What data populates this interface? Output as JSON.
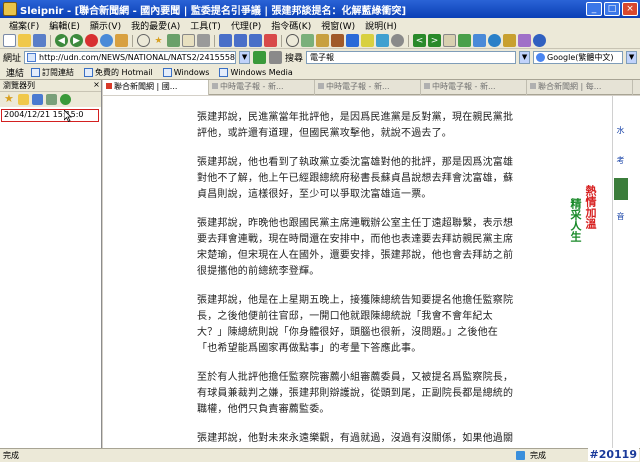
{
  "window": {
    "title": "Sleipnir - [聯合新聞網 - 國內要聞 | 監委提名引爭議 | 張建邦談提名：化解藍綠衝突]"
  },
  "menubar": {
    "items": [
      "檔案(F)",
      "編輯(E)",
      "顯示(V)",
      "我的最愛(A)",
      "工具(T)",
      "代理(P)",
      "指令碼(K)",
      "視窗(W)",
      "說明(H)"
    ]
  },
  "address": {
    "label": "網址",
    "url": "http://udn.com/NEWS/NATIONAL/NATS2/2415558.shtml",
    "search_label": "搜尋",
    "search_value": "電子報",
    "engine": "Google(繁體中文)"
  },
  "links": {
    "label": "連結",
    "items": [
      "訂閱連結",
      "免費的 Hotmail",
      "Windows",
      "Windows Media"
    ]
  },
  "sidebar": {
    "title": "瀏覽器列",
    "history_entry": "2004/12/21 15:15:0"
  },
  "tabs": [
    {
      "label": "聯合新聞網 | 國...",
      "active": true
    },
    {
      "label": "中時電子報 - 新...",
      "active": false
    },
    {
      "label": "中時電子報 - 新...",
      "active": false
    },
    {
      "label": "中時電子報 - 新...",
      "active": false
    },
    {
      "label": "聯合新聞網 | 每...",
      "active": false
    }
  ],
  "article": {
    "paragraphs": [
      "張建邦說，民進黨當年批評他，是因爲民進黨是反對黨，現在親民黨批評他，或許還有道理，但國民黨攻擊他，就說不過去了。",
      "張建邦說，他也看到了執政黨立委沈富雄對他的批評，那是因爲沈富雄對他不了解，他上午已經跟總統府秘書長蘇貞昌說想去拜會沈富雄，蘇貞昌則說，這樣很好，至少可以爭取沈富雄這一票。",
      "張建邦說，昨晚他也跟國民黨主席連戰辦公室主任丁遠超聯繫，表示想要去拜會連戰，現在時間還在安排中，而他也表達要去拜訪親民黨主席宋楚瑜，但宋現在人在國外，還要安排，張建邦說，他也會去拜訪之前很提攜他的前總統李登輝。",
      "張建邦說，他是在上星期五晚上，接獲陳總統告知要提名他擔任監察院長，之後他便前往官邸，一開口他就跟陳總統說「我會不會年紀太大？」陳總統則說「你身體很好，頭腦也很新，沒問題。」之後他在「也希望能爲國家再做點事」的考量下答應此事。",
      "至於有人批評他擔任監察院審薦小組審薦委員，又被提名爲監察院長，有球員兼裁判之嫌，張建邦則辯護說，從頭到尾，正副院長都是總統的職權，他們只負責審薦監委。",
      "張建邦說，他對未來永遠樂觀，有過就過，沒過有沒關係，如果他過關了，他絕對會謹守中立，不管政黨的事，完全只處理國家的"
    ]
  },
  "promo": {
    "line1": "精采人生",
    "line2": "熱情加溫"
  },
  "side_ad": {
    "t1": "水",
    "t2": "考",
    "t3": "音"
  },
  "status": {
    "left": "完成",
    "zone": "完成",
    "watermark": "#20119"
  },
  "colors": {
    "title_bar": "#0a3fb5",
    "highlight_border": "#d32020"
  }
}
